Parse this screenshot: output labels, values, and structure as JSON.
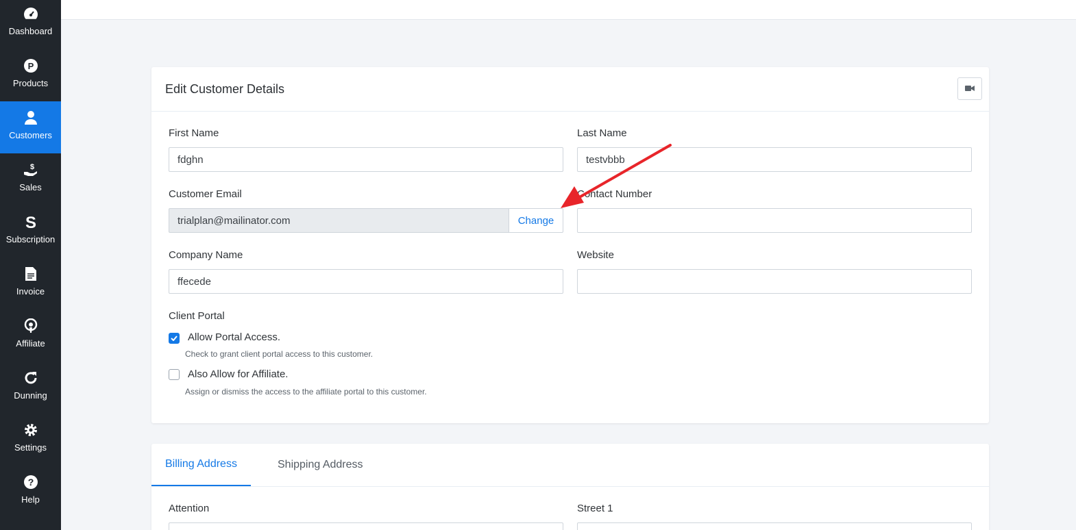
{
  "sidebar": {
    "items": [
      {
        "label": "Dashboard",
        "icon": "dashboard-icon",
        "active": false
      },
      {
        "label": "Products",
        "icon": "products-icon",
        "active": false
      },
      {
        "label": "Customers",
        "icon": "user-icon",
        "active": true
      },
      {
        "label": "Sales",
        "icon": "sales-icon",
        "active": false
      },
      {
        "label": "Subscription",
        "icon": "subscription-icon",
        "active": false
      },
      {
        "label": "Invoice",
        "icon": "invoice-icon",
        "active": false
      },
      {
        "label": "Affiliate",
        "icon": "affiliate-icon",
        "active": false
      },
      {
        "label": "Dunning",
        "icon": "refresh-icon",
        "active": false
      },
      {
        "label": "Settings",
        "icon": "gear-icon",
        "active": false
      },
      {
        "label": "Help",
        "icon": "help-icon",
        "active": false
      }
    ]
  },
  "card": {
    "title": "Edit Customer Details",
    "video_icon": "video-camera-icon"
  },
  "form": {
    "first_name_label": "First Name",
    "first_name_value": "fdghn",
    "last_name_label": "Last Name",
    "last_name_value": "testvbbb",
    "email_label": "Customer Email",
    "email_value": "trialplan@mailinator.com",
    "change_label": "Change",
    "contact_label": "Contact Number",
    "contact_value": "",
    "company_label": "Company Name",
    "company_value": "ffecede",
    "website_label": "Website",
    "website_value": "",
    "client_portal_label": "Client Portal",
    "portal_access_label": "Allow Portal Access.",
    "portal_access_checked": true,
    "portal_access_help": "Check to grant client portal access to this customer.",
    "affiliate_label": "Also Allow for Affiliate.",
    "affiliate_checked": false,
    "affiliate_help": "Assign or dismiss the access to the affiliate portal to this customer."
  },
  "address": {
    "tabs": [
      {
        "label": "Billing Address",
        "active": true
      },
      {
        "label": "Shipping Address",
        "active": false
      }
    ],
    "attention_label": "Attention",
    "street1_label": "Street 1"
  },
  "colors": {
    "accent": "#1479e6",
    "sidebar_bg": "#21262c",
    "annotation_arrow": "#e8252a"
  }
}
